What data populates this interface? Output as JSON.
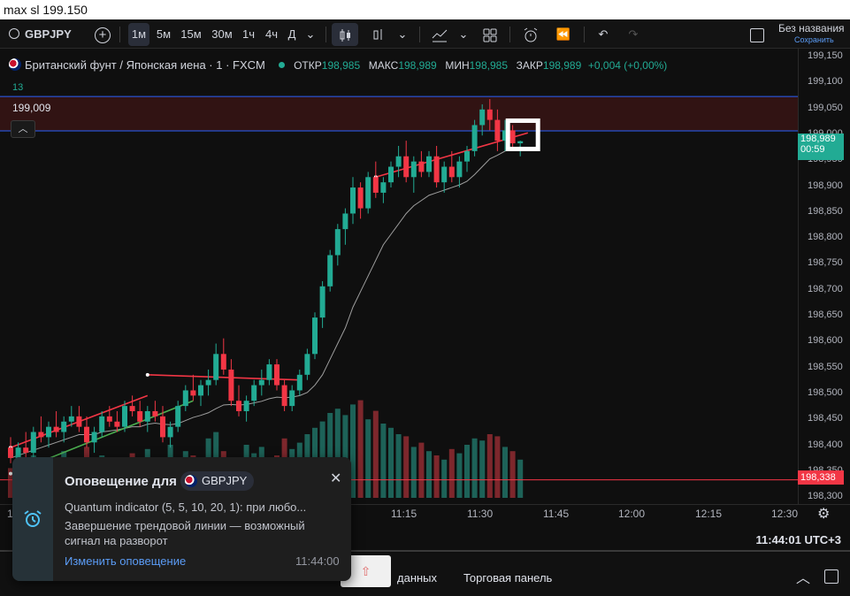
{
  "caption": "max sl 199.150",
  "toolbar": {
    "symbol": "GBPJPY",
    "intervals": [
      "1м",
      "5м",
      "15м",
      "30м",
      "1ч",
      "4ч",
      "Д"
    ],
    "active_interval": "1м",
    "layout_name": "Без названия",
    "save_label": "Сохранить"
  },
  "legend": {
    "title": "Британский фунт / Японская иена · 1 · FXCM",
    "open_label": "ОТКР",
    "open": "198,985",
    "high_label": "МАКС",
    "high": "198,989",
    "low_label": "МИН",
    "low": "198,985",
    "close_label": "ЗАКР",
    "close": "198,989",
    "change": "+0,004 (+0,00%)",
    "indicator_value": "13",
    "alert_price": "199,009"
  },
  "price_axis": {
    "ticks": [
      "199,150",
      "199,100",
      "199,050",
      "199,000",
      "198,950",
      "198,900",
      "198,850",
      "198,800",
      "198,750",
      "198,700",
      "198,650",
      "198,600",
      "198,550",
      "198,500",
      "198,450",
      "198,400",
      "198,350",
      "198,300"
    ],
    "current_price": "198,989",
    "countdown": "00:59",
    "sl_price": "198,338"
  },
  "time_axis": {
    "labels": [
      "11:15",
      "11:30",
      "11:45",
      "12:00",
      "12:15",
      "12:30"
    ],
    "first_label": "1"
  },
  "status": {
    "clock": "11:44:01 UTC+3"
  },
  "bottom": {
    "tab_data": "данных",
    "tab_trading": "Торговая панель"
  },
  "alert": {
    "title": "Оповещение для",
    "symbol": "GBPJPY",
    "line1": "Quantum indicator (5, 5, 10, 20, 1): при любо...",
    "line2": "Завершение трендовой линии — возможный",
    "line3": "сигнал на разворот",
    "edit_link": "Изменить оповещение",
    "time": "11:44:00"
  },
  "colors": {
    "up": "#22ab94",
    "down": "#f23645",
    "bg": "#0f0f0f",
    "accent": "#2962ff"
  },
  "chart_data": {
    "type": "candlestick",
    "ylim": [
      198.3,
      199.15
    ],
    "candles": [
      [
        198.4,
        198.42,
        198.37,
        198.38
      ],
      [
        198.38,
        198.41,
        198.36,
        198.4
      ],
      [
        198.4,
        198.43,
        198.38,
        198.39
      ],
      [
        198.39,
        198.44,
        198.38,
        198.43
      ],
      [
        198.43,
        198.46,
        198.41,
        198.42
      ],
      [
        198.42,
        198.45,
        198.4,
        198.44
      ],
      [
        198.44,
        198.47,
        198.42,
        198.43
      ],
      [
        198.43,
        198.46,
        198.41,
        198.45
      ],
      [
        198.45,
        198.48,
        198.44,
        198.46
      ],
      [
        198.46,
        198.48,
        198.43,
        198.44
      ],
      [
        198.44,
        198.46,
        198.4,
        198.41
      ],
      [
        198.41,
        198.44,
        198.39,
        198.43
      ],
      [
        198.43,
        198.47,
        198.42,
        198.46
      ],
      [
        198.46,
        198.48,
        198.44,
        198.45
      ],
      [
        198.45,
        198.47,
        198.43,
        198.44
      ],
      [
        198.44,
        198.49,
        198.43,
        198.48
      ],
      [
        198.48,
        198.5,
        198.46,
        198.47
      ],
      [
        198.47,
        198.49,
        198.44,
        198.45
      ],
      [
        198.45,
        198.48,
        198.43,
        198.47
      ],
      [
        198.47,
        198.49,
        198.45,
        198.46
      ],
      [
        198.46,
        198.48,
        198.41,
        198.42
      ],
      [
        198.42,
        198.45,
        198.4,
        198.44
      ],
      [
        198.44,
        198.49,
        198.43,
        198.48
      ],
      [
        198.48,
        198.52,
        198.47,
        198.51
      ],
      [
        198.51,
        198.54,
        198.49,
        198.5
      ],
      [
        198.5,
        198.53,
        198.48,
        198.52
      ],
      [
        198.52,
        198.55,
        198.5,
        198.53
      ],
      [
        198.53,
        198.6,
        198.52,
        198.58
      ],
      [
        198.58,
        198.61,
        198.54,
        198.55
      ],
      [
        198.55,
        198.57,
        198.48,
        198.49
      ],
      [
        198.49,
        198.52,
        198.46,
        198.47
      ],
      [
        198.47,
        198.5,
        198.45,
        198.49
      ],
      [
        198.49,
        198.53,
        198.48,
        198.52
      ],
      [
        198.52,
        198.55,
        198.5,
        198.53
      ],
      [
        198.53,
        198.57,
        198.52,
        198.56
      ],
      [
        198.56,
        198.57,
        198.51,
        198.52
      ],
      [
        198.52,
        198.53,
        198.47,
        198.48
      ],
      [
        198.48,
        198.52,
        198.47,
        198.51
      ],
      [
        198.51,
        198.55,
        198.5,
        198.54
      ],
      [
        198.54,
        198.59,
        198.53,
        198.58
      ],
      [
        198.58,
        198.66,
        198.57,
        198.65
      ],
      [
        198.65,
        198.72,
        198.63,
        198.71
      ],
      [
        198.71,
        198.78,
        198.7,
        198.77
      ],
      [
        198.77,
        198.83,
        198.75,
        198.82
      ],
      [
        198.82,
        198.86,
        198.79,
        198.85
      ],
      [
        198.85,
        198.92,
        198.83,
        198.9
      ],
      [
        198.9,
        198.91,
        198.84,
        198.86
      ],
      [
        198.86,
        198.93,
        198.85,
        198.92
      ],
      [
        198.92,
        198.95,
        198.88,
        198.89
      ],
      [
        198.89,
        198.92,
        198.87,
        198.91
      ],
      [
        198.91,
        198.95,
        198.9,
        198.94
      ],
      [
        198.94,
        198.98,
        198.92,
        198.96
      ],
      [
        198.96,
        198.99,
        198.91,
        198.92
      ],
      [
        198.92,
        198.96,
        198.89,
        198.95
      ],
      [
        198.95,
        198.97,
        198.92,
        198.93
      ],
      [
        198.93,
        198.97,
        198.92,
        198.96
      ],
      [
        198.96,
        198.98,
        198.9,
        198.91
      ],
      [
        198.91,
        198.95,
        198.89,
        198.94
      ],
      [
        198.94,
        198.97,
        198.91,
        198.92
      ],
      [
        198.92,
        198.96,
        198.9,
        198.95
      ],
      [
        198.95,
        198.98,
        198.93,
        198.97
      ],
      [
        198.97,
        199.03,
        198.96,
        199.02
      ],
      [
        199.02,
        199.06,
        199.0,
        199.05
      ],
      [
        199.05,
        199.07,
        199.01,
        199.03
      ],
      [
        199.03,
        199.05,
        198.97,
        198.99
      ],
      [
        198.99,
        199.03,
        198.97,
        199.01
      ],
      [
        199.01,
        199.02,
        198.97,
        198.985
      ],
      [
        198.985,
        198.99,
        198.96,
        198.989
      ]
    ],
    "volumes": [
      28,
      34,
      22,
      40,
      30,
      36,
      26,
      44,
      30,
      38,
      48,
      32,
      40,
      28,
      36,
      30,
      42,
      34,
      46,
      38,
      30,
      50,
      36,
      44,
      40,
      32,
      56,
      62,
      44,
      38,
      36,
      50,
      42,
      48,
      34,
      40,
      56,
      46,
      52,
      60,
      66,
      72,
      80,
      84,
      78,
      88,
      92,
      74,
      82,
      70,
      66,
      60,
      58,
      48,
      52,
      44,
      40,
      36,
      46,
      42,
      50,
      56,
      54,
      60,
      58,
      48,
      44,
      36
    ],
    "ma": [
      198.38,
      198.385,
      198.39,
      198.395,
      198.4,
      198.405,
      198.41,
      198.415,
      198.42,
      198.425,
      198.425,
      198.425,
      198.43,
      198.432,
      198.434,
      198.437,
      198.44,
      198.44,
      198.445,
      198.447,
      198.445,
      198.444,
      198.446,
      198.452,
      198.458,
      198.462,
      198.467,
      198.475,
      198.482,
      198.483,
      198.482,
      198.483,
      198.486,
      198.489,
      198.494,
      198.497,
      198.496,
      198.497,
      198.5,
      198.506,
      198.52,
      198.54,
      198.57,
      198.6,
      198.63,
      198.67,
      198.7,
      198.73,
      198.76,
      198.79,
      198.81,
      198.83,
      198.85,
      198.865,
      198.875,
      198.885,
      198.89,
      198.895,
      198.9,
      198.905,
      198.912,
      198.925,
      198.94,
      198.955,
      198.962,
      198.97,
      198.975,
      198.978
    ],
    "trend_lines": [
      {
        "color": "#f23645",
        "from": [
          0,
          198.4
        ],
        "to": [
          18,
          198.5
        ]
      },
      {
        "color": "#f23645",
        "from": [
          18,
          198.54
        ],
        "to": [
          38,
          198.53
        ]
      },
      {
        "color": "#f23645",
        "from": [
          48,
          198.92
        ],
        "to": [
          68,
          199.005
        ]
      },
      {
        "color": "#4caf50",
        "from": [
          0,
          198.35
        ],
        "to": [
          24,
          198.49
        ]
      }
    ],
    "alert_level": 199.009,
    "sl_level": 198.338
  }
}
